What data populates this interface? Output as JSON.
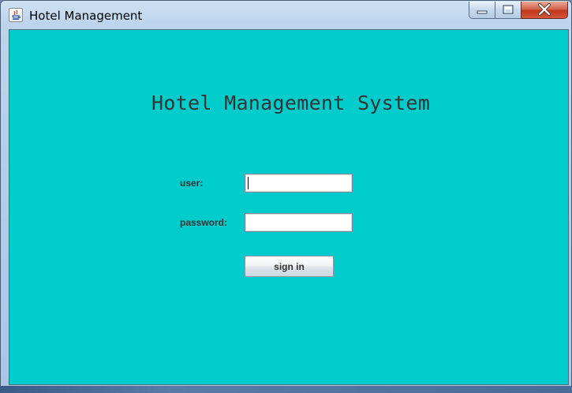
{
  "window": {
    "title": "Hotel Management",
    "controls": {
      "minimize_icon": "minimize-icon",
      "maximize_icon": "maximize-icon",
      "close_icon": "close-icon"
    },
    "app_icon": "java-icon"
  },
  "form": {
    "heading": "Hotel Management System",
    "user_label": "user:",
    "user_value": "",
    "password_label": "password:",
    "password_value": "",
    "signin_label": "sign in"
  },
  "colors": {
    "background": "#00cccc",
    "heading_text": "#333333",
    "close_button": "#c1361c"
  }
}
